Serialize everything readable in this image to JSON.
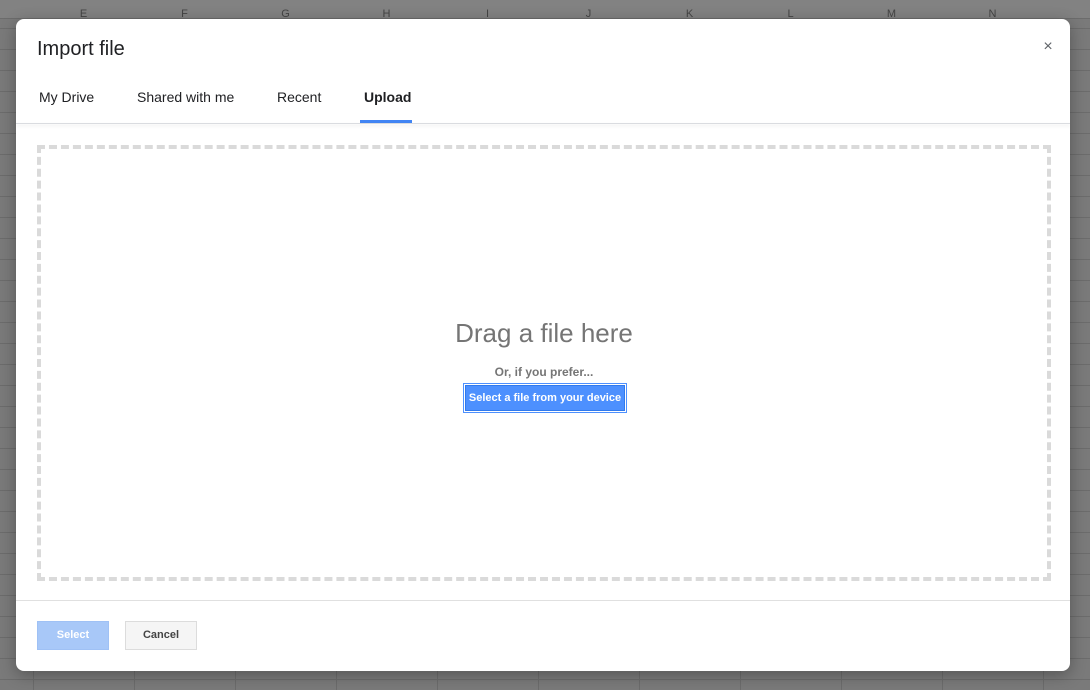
{
  "sheet": {
    "columns": [
      "E",
      "F",
      "G",
      "H",
      "I",
      "J",
      "K",
      "L",
      "M",
      "N"
    ]
  },
  "dialog": {
    "title": "Import file",
    "close_glyph": "×",
    "close_icon": "close-icon",
    "tabs": [
      {
        "label": "My Drive",
        "active": false
      },
      {
        "label": "Shared with me",
        "active": false
      },
      {
        "label": "Recent",
        "active": false
      },
      {
        "label": "Upload",
        "active": true
      }
    ],
    "upload": {
      "drag_text": "Drag a file here",
      "prefer_text": "Or, if you prefer...",
      "select_device_label": "Select a file from your device"
    },
    "footer": {
      "select_label": "Select",
      "select_enabled": false,
      "cancel_label": "Cancel"
    }
  },
  "colors": {
    "accent": "#4285f4",
    "primary_button": "#4d90fe",
    "disabled_button": "#a8c8f8"
  }
}
